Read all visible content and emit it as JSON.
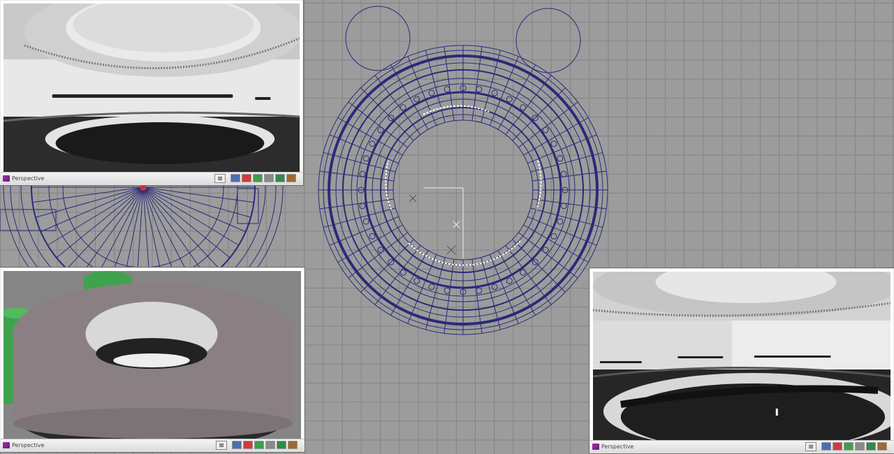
{
  "viewports": [
    {
      "key": "top-left",
      "title": "Perspective",
      "close_glyph": "⊠"
    },
    {
      "key": "bottom-left",
      "title": "Perspective",
      "close_glyph": "⊠"
    },
    {
      "key": "bottom-right",
      "title": "Perspective",
      "close_glyph": "⊠"
    }
  ],
  "toolbar_icons": [
    {
      "name": "shaded-mode-icon",
      "color": "#4a6fb5"
    },
    {
      "name": "textured-mode-icon",
      "color": "#d23a3a"
    },
    {
      "name": "lighting-icon",
      "color": "#3aa04a"
    },
    {
      "name": "camera-icon",
      "color": "#8a8a8a"
    },
    {
      "name": "fly-icon",
      "color": "#2f8a4a"
    },
    {
      "name": "walk-icon",
      "color": "#a06a2a"
    }
  ],
  "colors": {
    "grid_background": "#9c9c9c",
    "grid_line": "#808080",
    "wireframe": "#2a2a7a",
    "highlight": "#ffffff",
    "proxy_green": "#3fa34d",
    "ring_gray": "#8a8083"
  }
}
